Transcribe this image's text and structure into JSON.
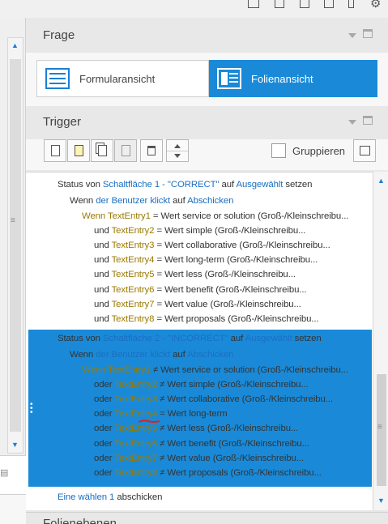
{
  "panels": {
    "frage": {
      "title": "Frage"
    },
    "trigger": {
      "title": "Trigger"
    },
    "next": {
      "title": "Folienebenen"
    }
  },
  "view_toggle": {
    "form_label": "Formularansicht",
    "slide_label": "Folienansicht",
    "selected": "Folienansicht"
  },
  "toolbar": {
    "group_label": "Gruppieren",
    "group_checked": false
  },
  "triggers": [
    {
      "action": {
        "prefix": "Status von",
        "target": "Schaltfläche 1 - \"CORRECT\"",
        "mid": "auf",
        "state": "Ausgewählt",
        "suffix": "setzen"
      },
      "when": {
        "prefix": "Wenn",
        "actor": "der Benutzer klickt",
        "mid": "auf",
        "object": "Abschicken"
      },
      "conditions": [
        {
          "conj": "Wenn",
          "var": "TextEntry1",
          "op": "=",
          "word": "Wert",
          "value": "service or solution",
          "opt": "(Groß-/Kleinschreibu..."
        },
        {
          "conj": "und",
          "var": "TextEntry2",
          "op": "=",
          "word": "Wert",
          "value": "simple",
          "opt": "(Groß-/Kleinschreibu..."
        },
        {
          "conj": "und",
          "var": "TextEntry3",
          "op": "=",
          "word": "Wert",
          "value": "collaborative",
          "opt": "(Groß-/Kleinschreibu..."
        },
        {
          "conj": "und",
          "var": "TextEntry4",
          "op": "=",
          "word": "Wert",
          "value": "long-term",
          "opt": "(Groß-/Kleinschreibu..."
        },
        {
          "conj": "und",
          "var": "TextEntry5",
          "op": "=",
          "word": "Wert",
          "value": "less",
          "opt": "(Groß-/Kleinschreibu..."
        },
        {
          "conj": "und",
          "var": "TextEntry6",
          "op": "=",
          "word": "Wert",
          "value": "benefit",
          "opt": "(Groß-/Kleinschreibu..."
        },
        {
          "conj": "und",
          "var": "TextEntry7",
          "op": "=",
          "word": "Wert",
          "value": "value",
          "opt": "(Groß-/Kleinschreibu..."
        },
        {
          "conj": "und",
          "var": "TextEntry8",
          "op": "=",
          "word": "Wert",
          "value": "proposals",
          "opt": "(Groß-/Kleinschreibu..."
        }
      ]
    },
    {
      "action": {
        "prefix": "Status von",
        "target": "Schaltfläche 2 - \"INCORRECT\"",
        "mid": "auf",
        "state": "Ausgewählt",
        "suffix": "setzen"
      },
      "when": {
        "prefix": "Wenn",
        "actor": "der Benutzer klickt",
        "mid": "auf",
        "object": "Abschicken"
      },
      "conditions": [
        {
          "conj": "Wenn",
          "var": "TextEntry1",
          "op": "≠",
          "word": "Wert",
          "value": "service or solution",
          "opt": "(Groß-/Kleinschreibu..."
        },
        {
          "conj": "oder",
          "var": "TextEntry2",
          "op": "≠",
          "word": "Wert",
          "value": "simple",
          "opt": "(Groß-/Kleinschreibu..."
        },
        {
          "conj": "oder",
          "var": "TextEntry3",
          "op": "≠",
          "word": "Wert",
          "value": "collaborative",
          "opt": "(Groß-/Kleinschreibu..."
        },
        {
          "conj": "oder",
          "var": "TextEntry4",
          "op": "=",
          "word": "Wert",
          "value": "long-term",
          "opt": ""
        },
        {
          "conj": "oder",
          "var": "TextEntry5",
          "op": "≠",
          "word": "Wert",
          "value": "less",
          "opt": "(Groß-/Kleinschreibu..."
        },
        {
          "conj": "oder",
          "var": "TextEntry6",
          "op": "≠",
          "word": "Wert",
          "value": "benefit",
          "opt": "(Groß-/Kleinschreibu..."
        },
        {
          "conj": "oder",
          "var": "TextEntry7",
          "op": "≠",
          "word": "Wert",
          "value": "value",
          "opt": "(Groß-/Kleinschreibu..."
        },
        {
          "conj": "oder",
          "var": "TextEntry8",
          "op": "≠",
          "word": "Wert",
          "value": "proposals",
          "opt": "(Groß-/Kleinschreibu..."
        }
      ]
    }
  ],
  "footer_line": {
    "part1": "Eine wählen",
    "count": "1",
    "part2": "abschicken"
  },
  "colors": {
    "accent": "#1a8ad8",
    "link": "#1a6fc2",
    "variable": "#9b7a00",
    "error_underline": "#e0201c"
  }
}
